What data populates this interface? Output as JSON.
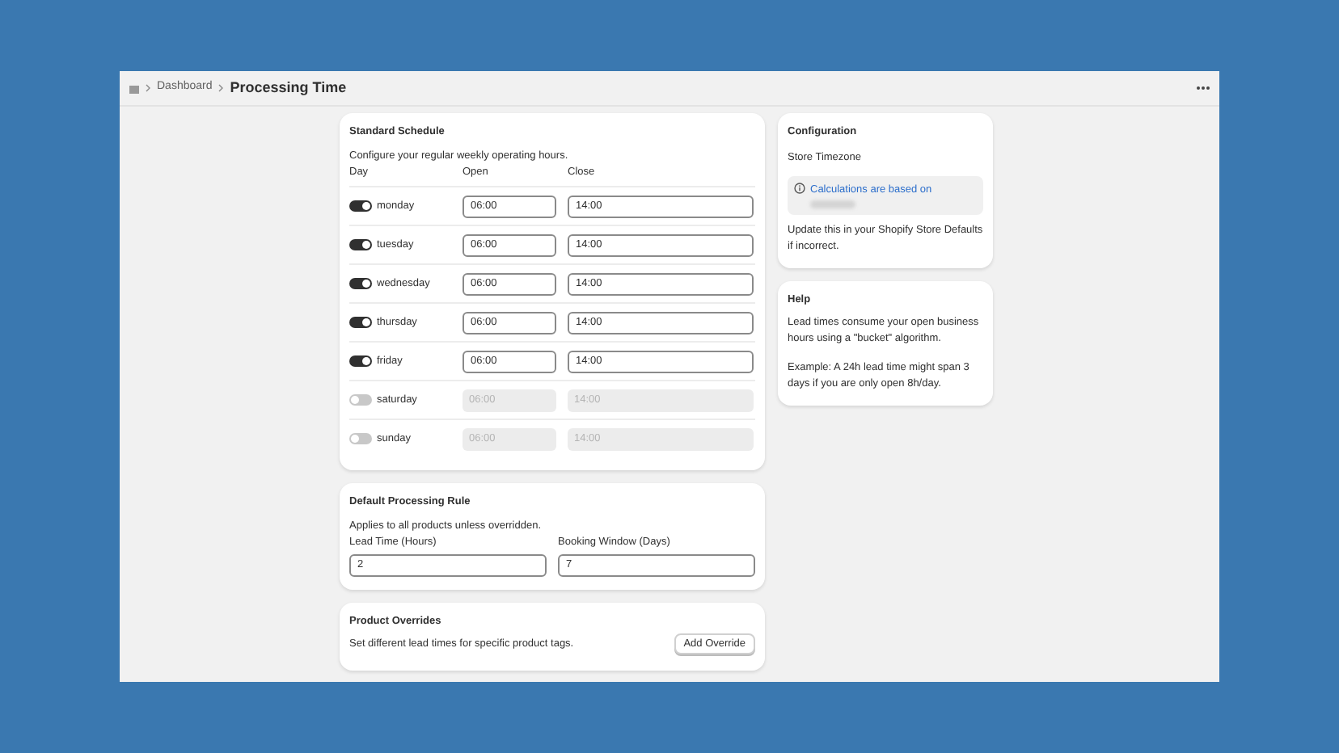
{
  "breadcrumb": {
    "parent": "Dashboard",
    "title": "Processing Time"
  },
  "schedule": {
    "title": "Standard Schedule",
    "description": "Configure your regular weekly operating hours.",
    "columns": [
      "Day",
      "Open",
      "Close"
    ],
    "days": [
      {
        "name": "monday",
        "on": true,
        "open": "06:00",
        "close": "14:00"
      },
      {
        "name": "tuesday",
        "on": true,
        "open": "06:00",
        "close": "14:00"
      },
      {
        "name": "wednesday",
        "on": true,
        "open": "06:00",
        "close": "14:00"
      },
      {
        "name": "thursday",
        "on": true,
        "open": "06:00",
        "close": "14:00"
      },
      {
        "name": "friday",
        "on": true,
        "open": "06:00",
        "close": "14:00"
      },
      {
        "name": "saturday",
        "on": false,
        "open": "06:00",
        "close": "14:00"
      },
      {
        "name": "sunday",
        "on": false,
        "open": "06:00",
        "close": "14:00"
      }
    ]
  },
  "default_rule": {
    "title": "Default Processing Rule",
    "description": "Applies to all products unless overridden.",
    "fields": [
      {
        "label": "Lead Time (Hours)",
        "value": "2"
      },
      {
        "label": "Booking Window (Days)",
        "value": "7"
      }
    ]
  },
  "overrides": {
    "title": "Product Overrides",
    "description": "Set different lead times for specific product tags.",
    "button": "Add Override"
  },
  "configuration": {
    "title": "Configuration",
    "subtitle": "Store Timezone",
    "notice": "Calculations are based on",
    "note": "Update this in your Shopify Store Defaults if incorrect."
  },
  "help": {
    "title": "Help",
    "paragraphs": [
      "Lead times consume your open business hours using a \"bucket\" algorithm.",
      "Example: A 24h lead time might span 3 days if you are only open 8h/day."
    ]
  }
}
